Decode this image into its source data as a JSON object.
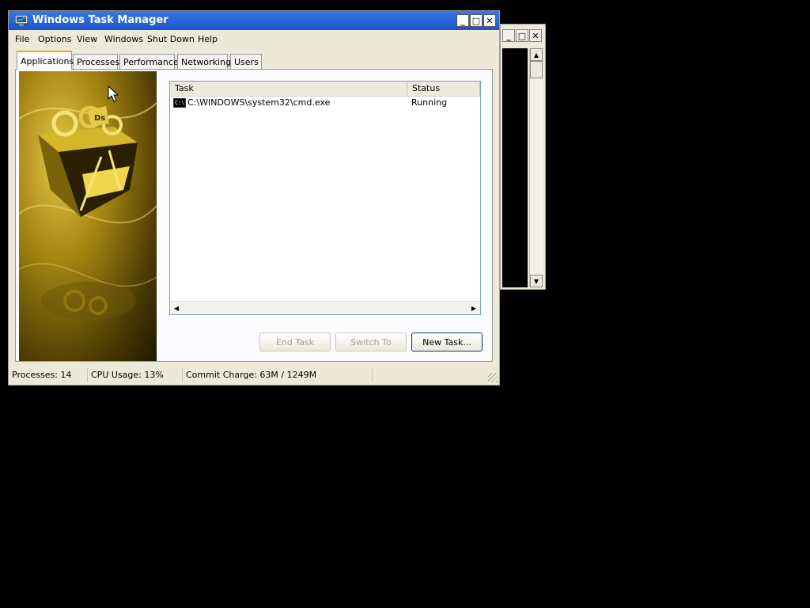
{
  "bg_window": {
    "buttons": {
      "minimize": "_",
      "maximize": "□",
      "close": "✕"
    }
  },
  "window": {
    "title": "Windows Task Manager",
    "buttons": {
      "minimize": "_",
      "maximize": "□",
      "close": "✕"
    }
  },
  "menu": [
    "File",
    "Options",
    "View",
    "Windows",
    "Shut Down",
    "Help"
  ],
  "tabs": [
    "Applications",
    "Processes",
    "Performance",
    "Networking",
    "Users"
  ],
  "active_tab": "Applications",
  "tasklist": {
    "columns": [
      "Task",
      "Status"
    ],
    "rows": [
      {
        "task": "C:\\WINDOWS\\system32\\cmd.exe",
        "status": "Running",
        "icon": "C:\\"
      }
    ]
  },
  "buttons": {
    "end_task": "End Task",
    "switch_to": "Switch To",
    "new_task": "New Task..."
  },
  "status": {
    "processes": "Processes: 14",
    "cpu": "CPU Usage: 13%",
    "commit": "Commit Charge: 63M / 1249M"
  },
  "colors": {
    "titlebar": "#1a55c8",
    "window_bg": "#ece9d8",
    "banner": "#a68612"
  }
}
